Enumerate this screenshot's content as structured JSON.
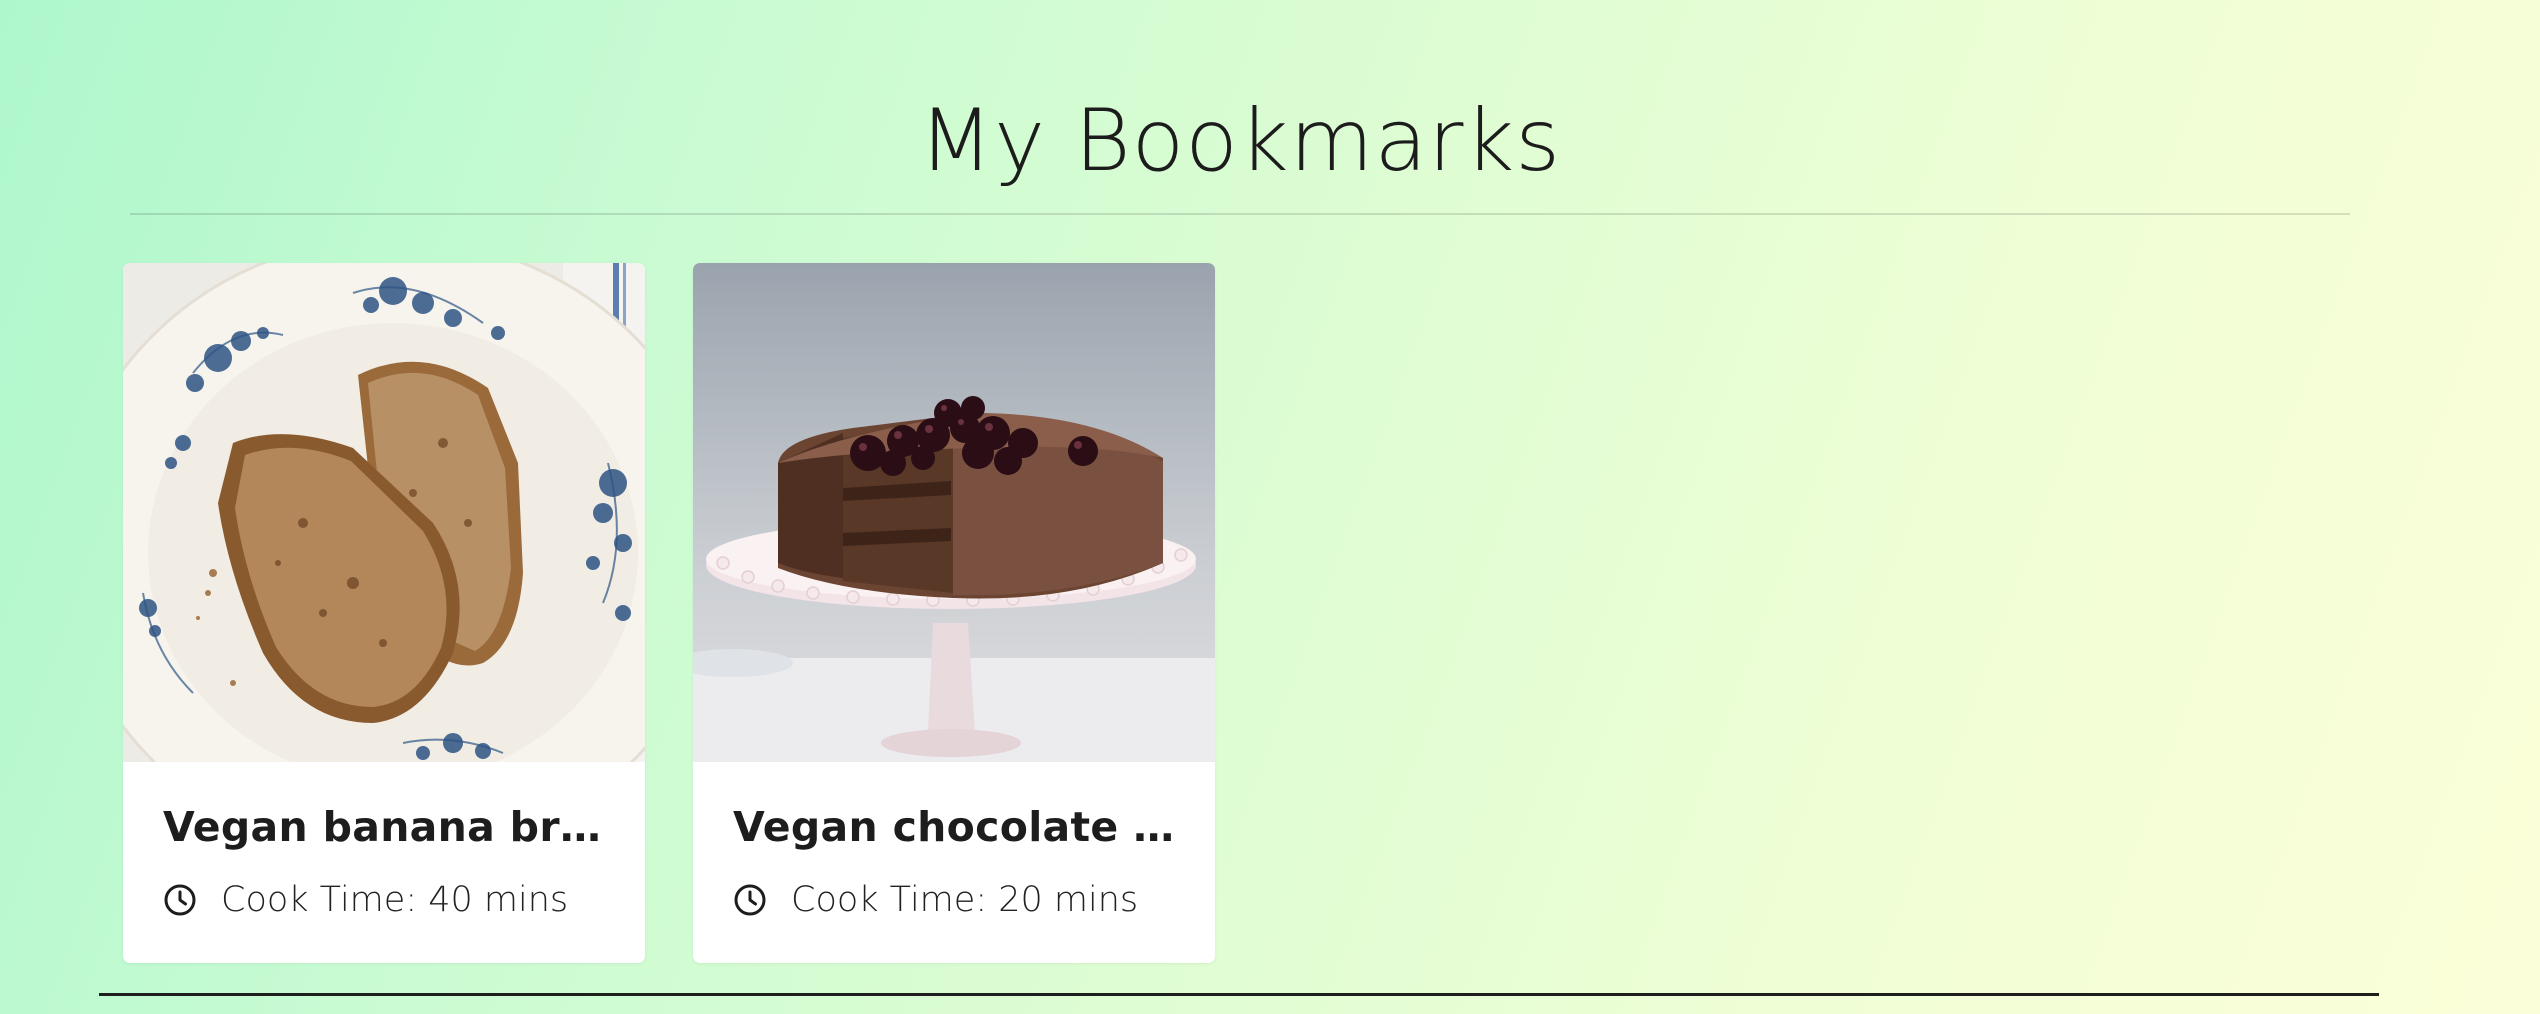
{
  "page": {
    "title": "My Bookmarks"
  },
  "bookmarks": [
    {
      "title": "Vegan banana bread",
      "cook_time": "Cook Time: 40 mins",
      "image": "banana-bread-photo"
    },
    {
      "title": "Vegan chocolate ca...",
      "cook_time": "Cook Time: 20 mins",
      "image": "chocolate-cake-photo"
    }
  ],
  "icons": {
    "clock": "clock-icon"
  },
  "colors": {
    "background_start": "#aef7cd",
    "background_end": "#fbffd9",
    "card_background": "#ffffff",
    "text": "#1d1d1d"
  }
}
